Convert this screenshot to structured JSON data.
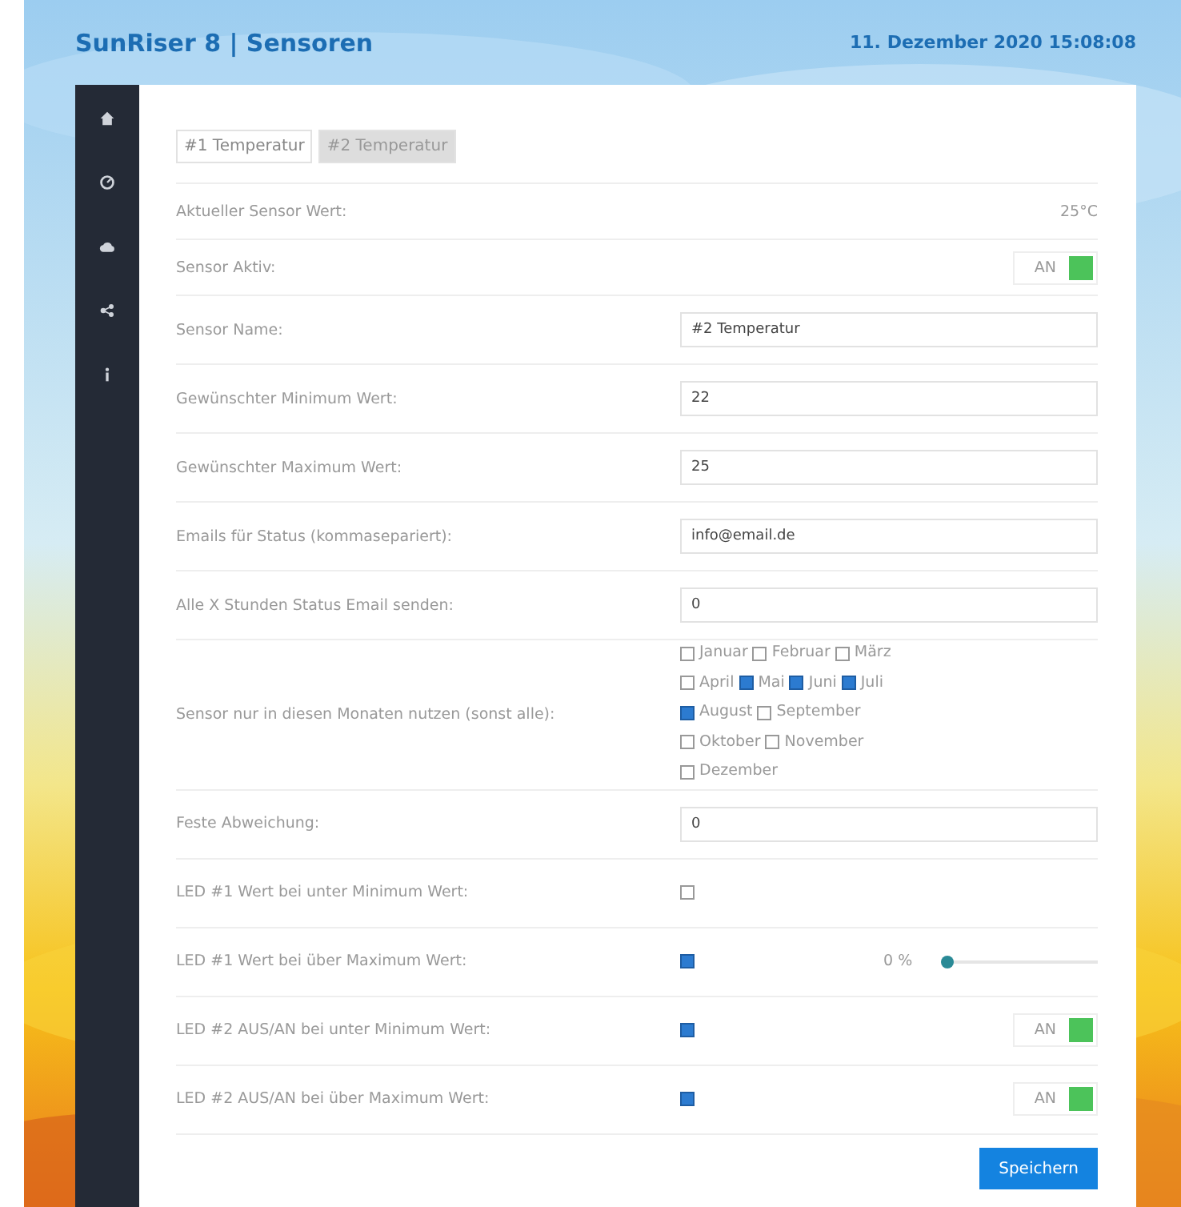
{
  "header": {
    "title": "SunRiser 8 | Sensoren",
    "datetime": "11. Dezember 2020 15:08:08"
  },
  "sidebar": {
    "items": [
      {
        "kind": "home"
      },
      {
        "kind": "gauge"
      },
      {
        "kind": "cloud"
      },
      {
        "kind": "share"
      },
      {
        "kind": "info"
      }
    ]
  },
  "tabs": [
    {
      "label": "#1 Temperatur",
      "selected": false
    },
    {
      "label": "#2 Temperatur",
      "selected": true
    }
  ],
  "rows": [
    {
      "kind": "value",
      "label": "Aktueller Sensor Wert:",
      "value": "25°C"
    },
    {
      "kind": "toggle",
      "label": "Sensor Aktiv:",
      "toggle": {
        "text": "AN",
        "on": true
      }
    },
    {
      "kind": "input",
      "label": "Sensor Name:",
      "value": "#2 Temperatur"
    },
    {
      "kind": "input",
      "label": "Gewünschter Minimum Wert:",
      "value": "22"
    },
    {
      "kind": "input",
      "label": "Gewünschter Maximum Wert:",
      "value": "25"
    },
    {
      "kind": "input",
      "label": "Emails für Status (kommasepariert):",
      "value": "info@email.de"
    },
    {
      "kind": "input",
      "label": "Alle X Stunden Status Email senden:",
      "value": "0"
    },
    {
      "kind": "months",
      "label": "Sensor nur in diesen Monaten nutzen (sonst alle):",
      "months": [
        {
          "label": "Januar",
          "checked": false
        },
        {
          "label": "Februar",
          "checked": false
        },
        {
          "label": "März",
          "checked": false
        },
        {
          "label": "April",
          "checked": false
        },
        {
          "label": "Mai",
          "checked": true
        },
        {
          "label": "Juni",
          "checked": true
        },
        {
          "label": "Juli",
          "checked": true
        },
        {
          "label": "August",
          "checked": true
        },
        {
          "label": "September",
          "checked": false
        },
        {
          "label": "Oktober",
          "checked": false
        },
        {
          "label": "November",
          "checked": false
        },
        {
          "label": "Dezember",
          "checked": false
        }
      ]
    },
    {
      "kind": "input",
      "label": "Feste Abweichung:",
      "value": "0"
    },
    {
      "kind": "checkbox",
      "label": "LED #1 Wert bei unter Minimum Wert:",
      "checked": false
    },
    {
      "kind": "checkbox-slider",
      "label": "LED #1 Wert bei über Maximum Wert:",
      "checked": true,
      "reading": "0 %",
      "level": 0
    },
    {
      "kind": "checkbox-toggle",
      "label": "LED #2 AUS/AN bei unter Minimum Wert:",
      "checked": true,
      "toggle": {
        "text": "AN",
        "on": true
      }
    },
    {
      "kind": "checkbox-toggle",
      "label": "LED #2 AUS/AN bei über Maximum Wert:",
      "checked": true,
      "toggle": {
        "text": "AN",
        "on": true
      }
    }
  ],
  "save_button": "Speichern"
}
